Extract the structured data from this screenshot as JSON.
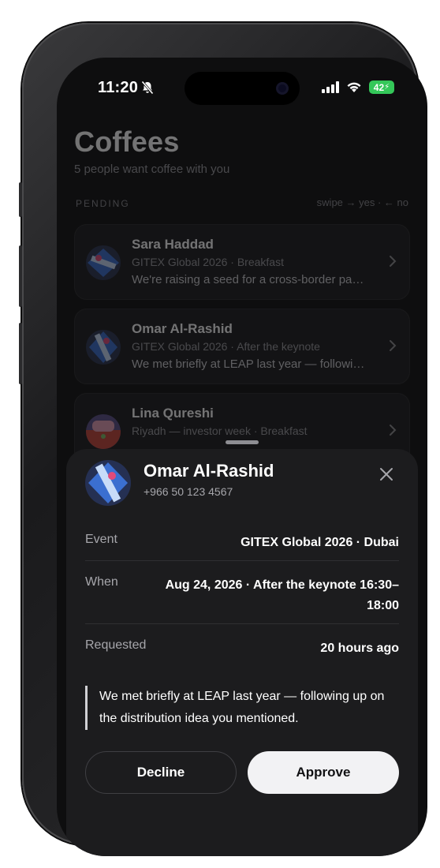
{
  "status_bar": {
    "time": "11:20",
    "battery": "42"
  },
  "header": {
    "title": "Coffees",
    "subtitle": "5 people want coffee with you"
  },
  "section": {
    "label": "PENDING",
    "hint": "swipe → yes · ← no"
  },
  "requests": [
    {
      "name": "Sara Haddad",
      "meta": "GITEX Global 2026 · Breakfast",
      "note": "We're raising a seed for a cross-border payments startup"
    },
    {
      "name": "Omar Al-Rashid",
      "meta": "GITEX Global 2026 · After the keynote",
      "note": "We met briefly at LEAP last year — following up"
    },
    {
      "name": "Lina Qureshi",
      "meta": "Riyadh — investor week · Breakfast",
      "note": ""
    }
  ],
  "sheet": {
    "name": "Omar Al-Rashid",
    "phone": "+966 50 123 4567",
    "event_label": "Event",
    "event_value": "GITEX Global 2026 · Dubai",
    "when_label": "When",
    "when_value_line1": "Aug 24, 2026 · After the keynote 16:30–",
    "when_value_line2": "18:00",
    "requested_label": "Requested",
    "requested_value": "20 hours ago",
    "message": "We met briefly at LEAP last year — following up on the distribution idea you mentioned.",
    "decline_label": "Decline",
    "approve_label": "Approve"
  },
  "colors": {
    "background": "#0e0e0f",
    "card": "#1c1c1e",
    "battery": "#34c759",
    "approve_bg": "#f2f2f4"
  },
  "icons": {
    "bell": "bell-slash-icon",
    "close": "close-icon",
    "chevron": "chevron-right-icon"
  }
}
